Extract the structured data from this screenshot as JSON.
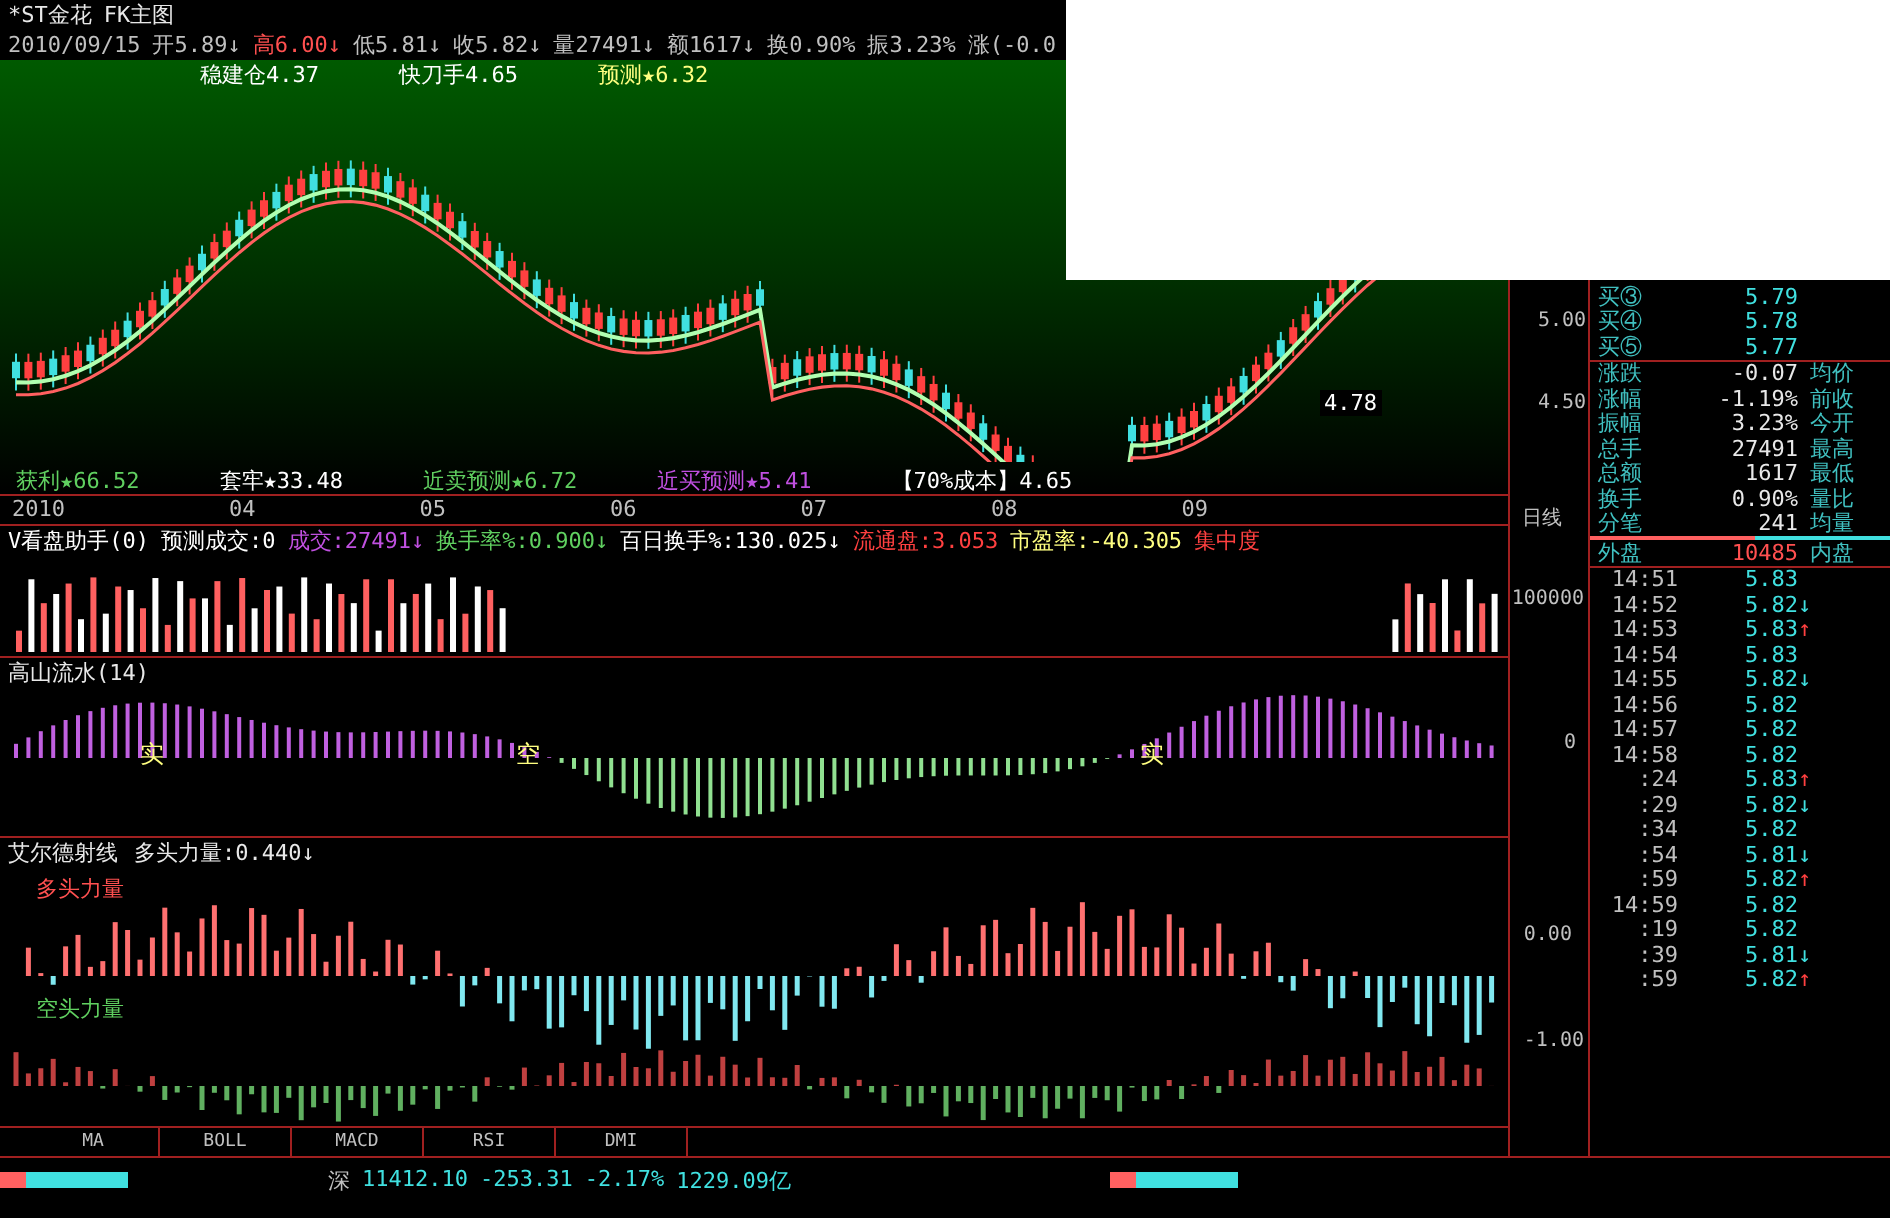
{
  "header": {
    "title": "*ST金花",
    "subtitle": "FK主图"
  },
  "quote_line": [
    {
      "text": "2010/09/15",
      "color": "#c0c0c0"
    },
    {
      "text": "开5.89↓",
      "color": "#c0c0c0"
    },
    {
      "text": "高6.00↓",
      "color": "#ff5050"
    },
    {
      "text": "低5.81↓",
      "color": "#c0c0c0"
    },
    {
      "text": "收5.82↓",
      "color": "#c0c0c0"
    },
    {
      "text": "量27491↓",
      "color": "#c0c0c0"
    },
    {
      "text": "额1617↓",
      "color": "#c0c0c0"
    },
    {
      "text": "换0.90%",
      "color": "#c0c0c0"
    },
    {
      "text": "振3.23%",
      "color": "#c0c0c0"
    },
    {
      "text": "涨(-0.0",
      "color": "#c0c0c0"
    }
  ],
  "main_indicators": [
    {
      "text": "稳建仓4.37",
      "color": "#ffffff"
    },
    {
      "text": "快刀手4.65",
      "color": "#ffffff"
    },
    {
      "text": "预测★6.32",
      "color": "#ffff80"
    }
  ],
  "bottom_indicators": [
    {
      "text": "获利★66.52",
      "color": "#60d060"
    },
    {
      "text": "套牢★33.48",
      "color": "#ffffff"
    },
    {
      "text": "近卖预测★6.72",
      "color": "#60d060"
    },
    {
      "text": "近买预测★5.41",
      "color": "#c050e0"
    },
    {
      "text": "【70%成本】4.65",
      "color": "#ffffff"
    }
  ],
  "price_axis": [
    "5.00",
    "4.50"
  ],
  "price_label": "4.78",
  "date_axis": {
    "labels": [
      "2010",
      "04",
      "05",
      "06",
      "07",
      "08",
      "09"
    ],
    "period": "日线"
  },
  "volume_header": [
    {
      "text": "V看盘助手(0)",
      "color": "#ffffff"
    },
    {
      "text": "预测成交:0",
      "color": "#ffffff"
    },
    {
      "text": "成交:27491↓",
      "color": "#c050e0"
    },
    {
      "text": "换手率%:0.900↓",
      "color": "#60d060"
    },
    {
      "text": "百日换手%:130.025↓",
      "color": "#ffffff"
    },
    {
      "text": "流通盘:3.053",
      "color": "#ff4040"
    },
    {
      "text": "市盈率:-40.305",
      "color": "#ffff80"
    },
    {
      "text": "集中度",
      "color": "#ff4040"
    }
  ],
  "volume_axis": [
    "100000"
  ],
  "flow_panel": {
    "title": "高山流水(14)",
    "markers": [
      "实",
      "空",
      "实"
    ],
    "axis": [
      "0"
    ]
  },
  "elder_panel": {
    "title": "艾尔德射线",
    "value": "多头力量:0.440↓",
    "bull_label": "多头力量",
    "bear_label": "空头力量",
    "axis": [
      "0.00",
      "-1.00"
    ]
  },
  "tabs": [
    {
      "label": "MA"
    },
    {
      "label": "BOLL"
    },
    {
      "label": "MACD"
    },
    {
      "label": "RSI"
    },
    {
      "label": "DMI"
    }
  ],
  "status_bar": {
    "market": "深",
    "index": "11412.10",
    "change": "-253.31",
    "percent": "-2.17%",
    "turnover": "1229.09亿"
  },
  "bids": [
    {
      "label": "买③",
      "value": "5.79"
    },
    {
      "label": "买④",
      "value": "5.78"
    },
    {
      "label": "买⑤",
      "value": "5.77"
    }
  ],
  "stats": [
    {
      "label": "涨跌",
      "value": "-0.07",
      "label2": "均价"
    },
    {
      "label": "涨幅",
      "value": "-1.19%",
      "label2": "前收"
    },
    {
      "label": "振幅",
      "value": "3.23%",
      "label2": "今开"
    },
    {
      "label": "总手",
      "value": "27491",
      "label2": "最高"
    },
    {
      "label": "总额",
      "value": "1617",
      "label2": "最低"
    },
    {
      "label": "换手",
      "value": "0.90%",
      "label2": "量比"
    },
    {
      "label": "分笔",
      "value": "241",
      "label2": "均量"
    }
  ],
  "outer": {
    "label": "外盘",
    "value": "10485",
    "label2": "内盘"
  },
  "ticks": [
    {
      "time": "14:51",
      "price": "5.83"
    },
    {
      "time": "14:52",
      "price": "5.82",
      "arrow": "↓",
      "color": "#40e0e0"
    },
    {
      "time": "14:53",
      "price": "5.83",
      "arrow": "↑",
      "color": "#ff4040"
    },
    {
      "time": "14:54",
      "price": "5.83"
    },
    {
      "time": "14:55",
      "price": "5.82",
      "arrow": "↓",
      "color": "#40e0e0"
    },
    {
      "time": "14:56",
      "price": "5.82"
    },
    {
      "time": "14:57",
      "price": "5.82"
    },
    {
      "time": "14:58",
      "price": "5.82"
    },
    {
      "time": ":24",
      "price": "5.83",
      "arrow": "↑",
      "color": "#ff4040"
    },
    {
      "time": ":29",
      "price": "5.82",
      "arrow": "↓",
      "color": "#40e0e0"
    },
    {
      "time": ":34",
      "price": "5.82"
    },
    {
      "time": ":54",
      "price": "5.81",
      "arrow": "↓",
      "color": "#40e0e0"
    },
    {
      "time": ":59",
      "price": "5.82",
      "arrow": "↑",
      "color": "#ff4040"
    },
    {
      "time": "14:59",
      "price": "5.82"
    },
    {
      "time": ":19",
      "price": "5.82"
    },
    {
      "time": ":39",
      "price": "5.81",
      "arrow": "↓",
      "color": "#40e0e0"
    },
    {
      "time": ":59",
      "price": "5.82",
      "arrow": "↑",
      "color": "#ff4040"
    }
  ]
}
